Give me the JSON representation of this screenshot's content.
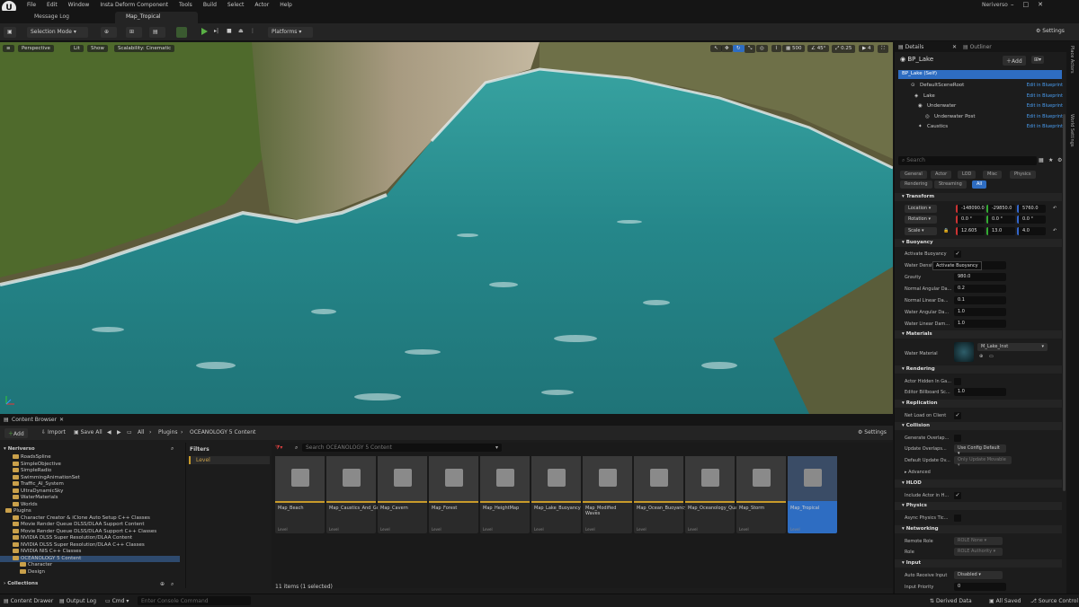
{
  "menubar": {
    "items": [
      "File",
      "Edit",
      "Window",
      "Insta Deform Component",
      "Tools",
      "Build",
      "Select",
      "Actor",
      "Help"
    ],
    "project": "Neriverso"
  },
  "tabs": [
    {
      "label": "Message Log"
    },
    {
      "label": "Map_Tropical"
    }
  ],
  "toolbar": {
    "selection_mode": "Selection Mode",
    "platforms": "Platforms",
    "settings": "Settings"
  },
  "viewport": {
    "perspective": "Perspective",
    "lit": "Lit",
    "show": "Show",
    "scalability": "Scalability: Cinematic",
    "snap_grid": "500",
    "snap_rot": "45°",
    "snap_scale": "0.25",
    "cam_speed": "4"
  },
  "content_browser": {
    "tab": "Content Browser",
    "add": "Add",
    "import": "Import",
    "save_all": "Save All",
    "breadcrumb": [
      "All",
      "Plugins",
      "OCEANOLOGY 5 Content"
    ],
    "settings": "Settings",
    "tree_root": "Neriverso",
    "tree": [
      {
        "label": "RoadsSpline",
        "level": 2
      },
      {
        "label": "SimpleObjective",
        "level": 2
      },
      {
        "label": "SimpleRadio",
        "level": 2
      },
      {
        "label": "SwimmingAnimationSet",
        "level": 2
      },
      {
        "label": "Traffic_AI_System",
        "level": 2
      },
      {
        "label": "UltraDynamicSky",
        "level": 2
      },
      {
        "label": "WaterMaterials",
        "level": 2
      },
      {
        "label": "Worlds",
        "level": 2
      },
      {
        "label": "Plugins",
        "level": 1
      },
      {
        "label": "Character Creator & iClone Auto Setup C++ Classes",
        "level": 2
      },
      {
        "label": "Movie Render Queue DLSS/DLAA Support Content",
        "level": 2
      },
      {
        "label": "Movie Render Queue DLSS/DLAA Support C++ Classes",
        "level": 2
      },
      {
        "label": "NVIDIA DLSS Super Resolution/DLAA Content",
        "level": 2
      },
      {
        "label": "NVIDIA DLSS Super Resolution/DLAA C++ Classes",
        "level": 2
      },
      {
        "label": "NVIDIA NIS C++ Classes",
        "level": 2
      },
      {
        "label": "OCEANOLOGY 5 Content",
        "level": 2
      },
      {
        "label": "Character",
        "level": 3
      },
      {
        "label": "Design",
        "level": 3
      }
    ],
    "collections": "Collections",
    "filters_title": "Filters",
    "filter_level": "Level",
    "search_placeholder": "Search OCEANOLOGY 5 Content",
    "assets": [
      {
        "name": "Map_Beach",
        "type": "Level"
      },
      {
        "name": "Map_Caustics_And_GodRays",
        "type": "Level"
      },
      {
        "name": "Map_Cavern",
        "type": "Level"
      },
      {
        "name": "Map_Forest",
        "type": "Level"
      },
      {
        "name": "Map_HeightMap",
        "type": "Level"
      },
      {
        "name": "Map_Lake_Buoyancy",
        "type": "Level"
      },
      {
        "name": "Map_Modified Waves",
        "type": "Level"
      },
      {
        "name": "Map_Ocean_Buoyancy",
        "type": "Level"
      },
      {
        "name": "Map_Oceanology_QuadTree",
        "type": "Level"
      },
      {
        "name": "Map_Storm",
        "type": "Level"
      },
      {
        "name": "Map_Tropical",
        "type": "Level"
      }
    ],
    "item_count": "11 items (1 selected)"
  },
  "statusbar": {
    "content_drawer": "Content Drawer",
    "output_log": "Output Log",
    "cmd": "Cmd",
    "console_placeholder": "Enter Console Command",
    "derived_data": "Derived Data",
    "all_saved": "All Saved",
    "source_control": "Source Control"
  },
  "details": {
    "tab_details": "Details",
    "tab_outliner": "Outliner",
    "actor_name": "BP_Lake",
    "add": "Add",
    "self": "BP_Lake (Self)",
    "components": [
      {
        "name": "DefaultSceneRoot",
        "edit": "Edit in Blueprint"
      },
      {
        "name": "Lake",
        "edit": "Edit in Blueprint"
      },
      {
        "name": "Underwater",
        "edit": "Edit in Blueprint"
      },
      {
        "name": "Underwater Post",
        "edit": "Edit in Blueprint"
      },
      {
        "name": "Caustics",
        "edit": "Edit in Blueprint"
      }
    ],
    "search_placeholder": "Search",
    "filters": [
      "General",
      "Actor",
      "LOD",
      "Misc",
      "Physics",
      "Rendering",
      "Streaming",
      "All"
    ],
    "transform": {
      "title": "Transform",
      "location": {
        "label": "Location",
        "x": "-148090.0",
        "y": "-29850.0",
        "z": "5760.0"
      },
      "rotation": {
        "label": "Rotation",
        "x": "0.0 °",
        "y": "0.0 °",
        "z": "0.0 °"
      },
      "scale": {
        "label": "Scale",
        "x": "12.605",
        "y": "13.0",
        "z": "4.0"
      }
    },
    "buoyancy": {
      "title": "Buoyancy",
      "activate": "Activate Buoyancy",
      "tooltip": "Activate Buoyancy",
      "water_density": "Water Density",
      "gravity_label": "Gravity",
      "gravity": "980.0",
      "normal_angular_label": "Normal Angular Da...",
      "normal_angular": "0.2",
      "normal_linear_label": "Normal Linear Da...",
      "normal_linear": "0.1",
      "water_angular_label": "Water Angular Da...",
      "water_angular": "1.0",
      "water_linear_label": "Water Linear Dam...",
      "water_linear": "1.0"
    },
    "materials": {
      "title": "Materials",
      "water_material_label": "Water Material",
      "water_material": "M_Lake_Inst"
    },
    "rendering": {
      "title": "Rendering",
      "actor_hidden": "Actor Hidden In Ga...",
      "billboard_label": "Editor Billboard Sc...",
      "billboard": "1.0"
    },
    "replication": {
      "title": "Replication",
      "net_load": "Net Load on Client"
    },
    "collision": {
      "title": "Collision",
      "gen_overlap": "Generate Overlap...",
      "update_overlap_label": "Update Overlaps...",
      "update_overlap": "Use Config Default",
      "default_update_label": "Default Update Ov...",
      "default_update": "Only Update Movable"
    },
    "advanced": "Advanced",
    "hlod": {
      "title": "HLOD",
      "include": "Include Actor in H..."
    },
    "physics": {
      "title": "Physics",
      "async": "Async Physics Tic..."
    },
    "networking": {
      "title": "Networking",
      "remote_role_label": "Remote Role",
      "remote_role": "ROLE None",
      "role_label": "Role",
      "role": "ROLE Authority"
    },
    "input": {
      "title": "Input",
      "auto_receive_label": "Auto Receive Input",
      "auto_receive": "Disabled",
      "priority_label": "Input Priority",
      "priority": "0"
    }
  },
  "right_strip": {
    "place_actors": "Place Actors",
    "world_settings": "World Settings"
  },
  "colors": {
    "accent": "#2e6dc2",
    "folder": "#c9a04a",
    "play": "#59b145",
    "link": "#4a9ff5",
    "water": "#2a8a8a"
  }
}
